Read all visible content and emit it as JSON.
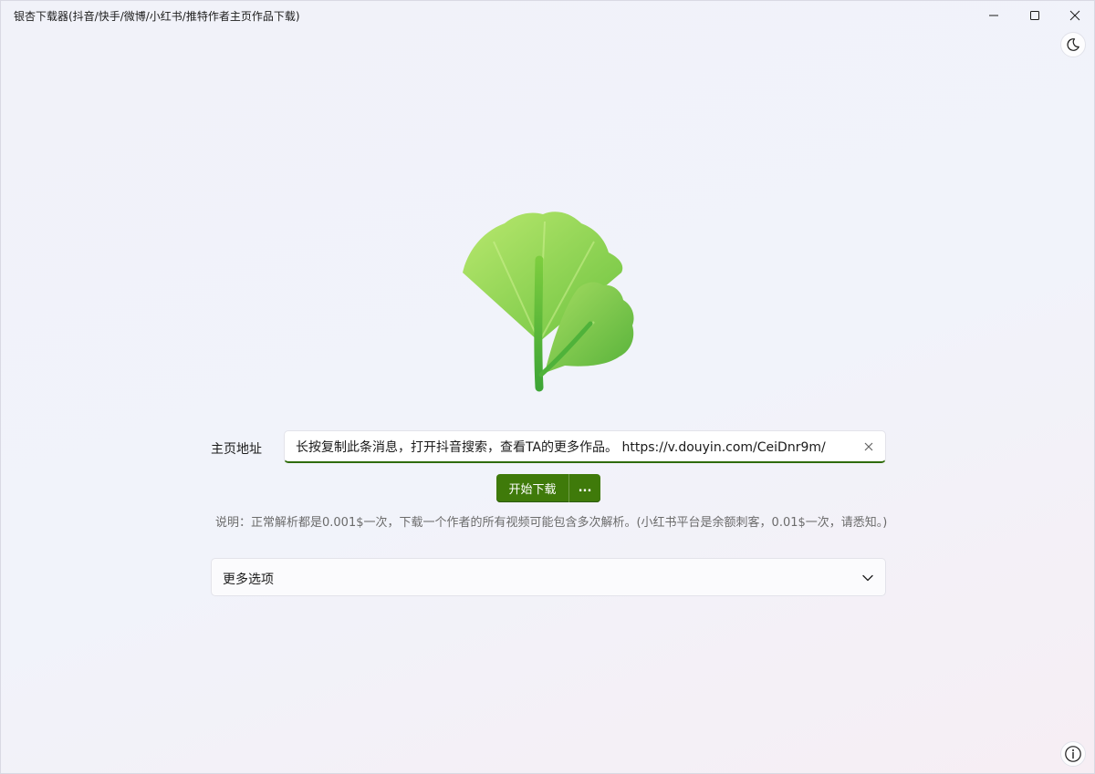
{
  "window": {
    "title": "银杏下载器(抖音/快手/微博/小红书/推特作者主页作品下载)"
  },
  "icons": {
    "theme": "moon-icon",
    "info": "info-icon",
    "logo": "ginkgo-leaf-logo",
    "clear": "close-icon",
    "expand": "chevron-down-icon"
  },
  "form": {
    "url_label": "主页地址",
    "url_value": "长按复制此条消息，打开抖音搜索，查看TA的更多作品。 https://v.douyin.com/CeiDnr9m/",
    "start_button_label": "开始下载",
    "more_button_label": "...",
    "note": "说明：正常解析都是0.001$一次，下载一个作者的所有视频可能包含多次解析。(小红书平台是余额刺客，0.01$一次，请悉知。)"
  },
  "more_options": {
    "label": "更多选项"
  },
  "colors": {
    "accent": "#3f7a0a",
    "input_underline": "#2e6b08",
    "leaf_light": "#b3e26a",
    "leaf_dark": "#4fb23a"
  }
}
